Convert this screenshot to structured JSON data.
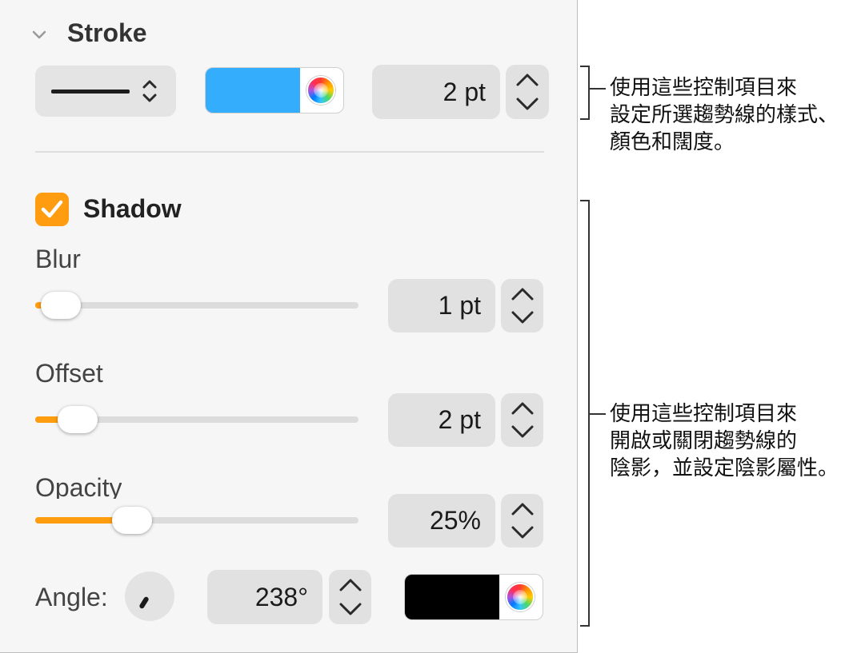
{
  "stroke": {
    "title": "Stroke",
    "color": "#34adfc",
    "width_value": "2 pt"
  },
  "shadow": {
    "title": "Shadow",
    "enabled": true,
    "accent": "#ff9c0f",
    "blur": {
      "label": "Blur",
      "value": "1 pt",
      "level": 0.02
    },
    "offset": {
      "label": "Offset",
      "value": "2 pt",
      "level": 0.08
    },
    "opacity": {
      "label": "Opacity",
      "value": "25%",
      "level": 0.27
    },
    "angle": {
      "label": "Angle:",
      "value": "238°"
    },
    "color": "#000000"
  },
  "callouts": {
    "stroke_lines": [
      "使用這些控制項目來",
      "設定所選趨勢線的樣式、",
      "顏色和闊度。"
    ],
    "shadow_lines": [
      "使用這些控制項目來",
      "開啟或關閉趨勢線的",
      "陰影，並設定陰影屬性。"
    ]
  },
  "icons": {
    "disclosure": "chevron-down-icon",
    "popup": "updown-chevron-icon",
    "color_wheel": "color-wheel-icon",
    "checkbox": "checkmark-icon",
    "stepper_up": "chevron-up-icon",
    "stepper_down": "chevron-down-icon"
  }
}
